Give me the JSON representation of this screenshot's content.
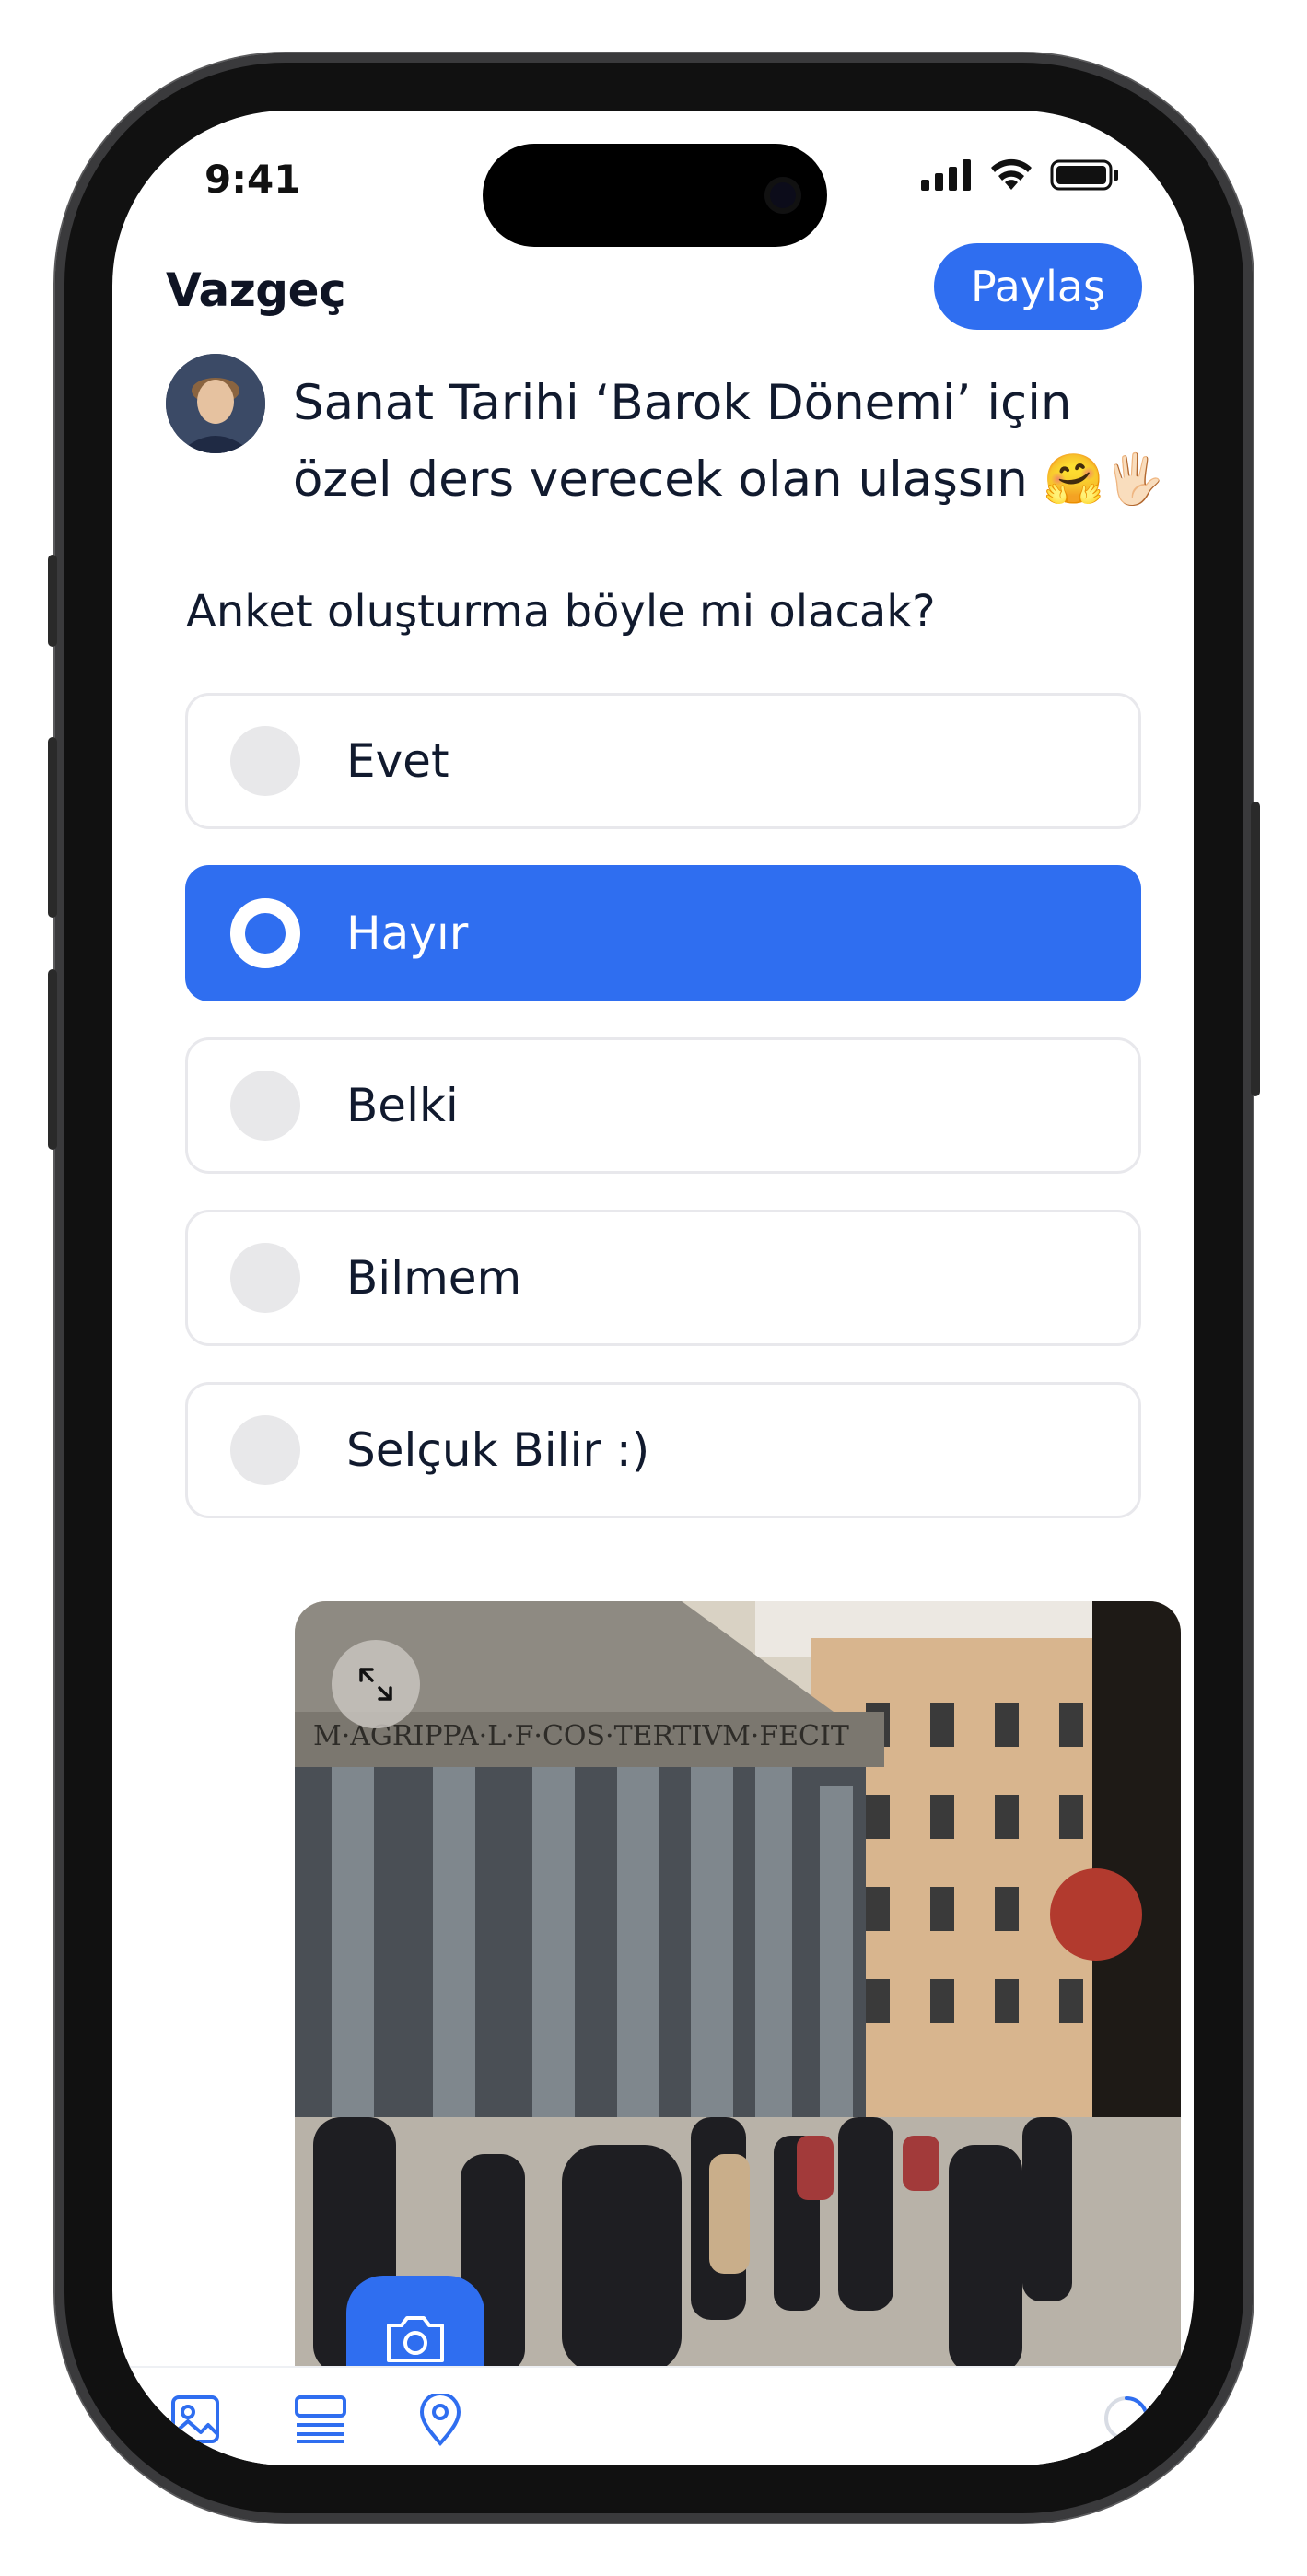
{
  "status_bar": {
    "time": "9:41"
  },
  "header": {
    "cancel_label": "Vazgeç",
    "share_label": "Paylaş"
  },
  "post": {
    "text": "Sanat Tarihi ‘Barok Dönemi’ için özel ders verecek olan ulaşsın 🤗🖐🏻"
  },
  "poll": {
    "question": "Anket oluşturma böyle mi olacak?",
    "options": [
      {
        "label": "Evet",
        "selected": false
      },
      {
        "label": "Hayır",
        "selected": true
      },
      {
        "label": "Belki",
        "selected": false
      },
      {
        "label": "Bilmem",
        "selected": false
      },
      {
        "label": "Selçuk Bilir :)",
        "selected": false
      }
    ]
  },
  "photo": {
    "inscription": "M·AGRIPPA·L·F·COS·TERTIVM·FECIT"
  },
  "toolbar": {
    "icons": [
      "image-icon",
      "list-icon",
      "location-icon",
      "loading-spinner-icon"
    ]
  },
  "colors": {
    "accent": "#2f6ef0",
    "text": "#111a2e",
    "option_border": "#e8e8ec",
    "radio_idle": "#e8e8ea"
  }
}
